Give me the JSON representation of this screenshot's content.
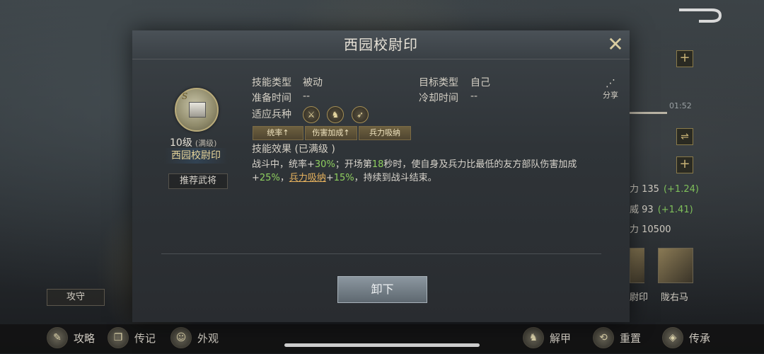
{
  "modal": {
    "title": "西园校尉印",
    "close_icon": "close-x-icon"
  },
  "skill": {
    "grade": "S",
    "level": "10级",
    "level_max": "(满级)",
    "name": "西园校尉印",
    "recommend_label": "推荐武将"
  },
  "details": {
    "skill_type_label": "技能类型",
    "skill_type_value": "被动",
    "target_type_label": "目标类型",
    "target_type_value": "自己",
    "prep_time_label": "准备时间",
    "prep_time_value": "--",
    "cooldown_label": "冷却时间",
    "cooldown_value": "--",
    "troop_label": "适应兵种",
    "troops": [
      "infantry-icon",
      "cavalry-icon",
      "archer-icon"
    ],
    "tags": [
      "统率↑",
      "伤害加成↑",
      "兵力吸纳"
    ],
    "effect_label": "技能效果 (已满级 )",
    "effect": {
      "p1": "战斗中，统率+",
      "n1": "30%",
      "p2": "；开场第",
      "n2": "18",
      "p3": "秒时，使自身及兵力比最低的友方部队伤害加成+",
      "n3": "25%",
      "p4": "，",
      "kw": "兵力吸纳",
      "p5": "+",
      "n4": "15%",
      "p6": "，持续到战斗结束。"
    },
    "share_label": "分享"
  },
  "actions": {
    "unload_label": "卸下"
  },
  "right_panel": {
    "timer": "01:52",
    "timer_progress": 0.9,
    "stats": [
      {
        "label": "力 135",
        "delta": "(+1.24)"
      },
      {
        "label": "威 93",
        "delta": "(+1.41)"
      },
      {
        "label": "力 10500",
        "delta": ""
      }
    ],
    "thumb_labels": [
      "尉印",
      "陇右马"
    ]
  },
  "left_panel": {
    "tab_label": "攻守"
  },
  "bottom_bar": {
    "left": [
      {
        "icon": "strategy-icon",
        "label": "攻略"
      },
      {
        "icon": "biography-icon",
        "label": "传记"
      },
      {
        "icon": "appearance-icon",
        "label": "外观"
      }
    ],
    "right": [
      {
        "icon": "unequip-icon",
        "label": "解甲"
      },
      {
        "icon": "reset-icon",
        "label": "重置"
      },
      {
        "icon": "inherit-icon",
        "label": "传承"
      }
    ]
  }
}
